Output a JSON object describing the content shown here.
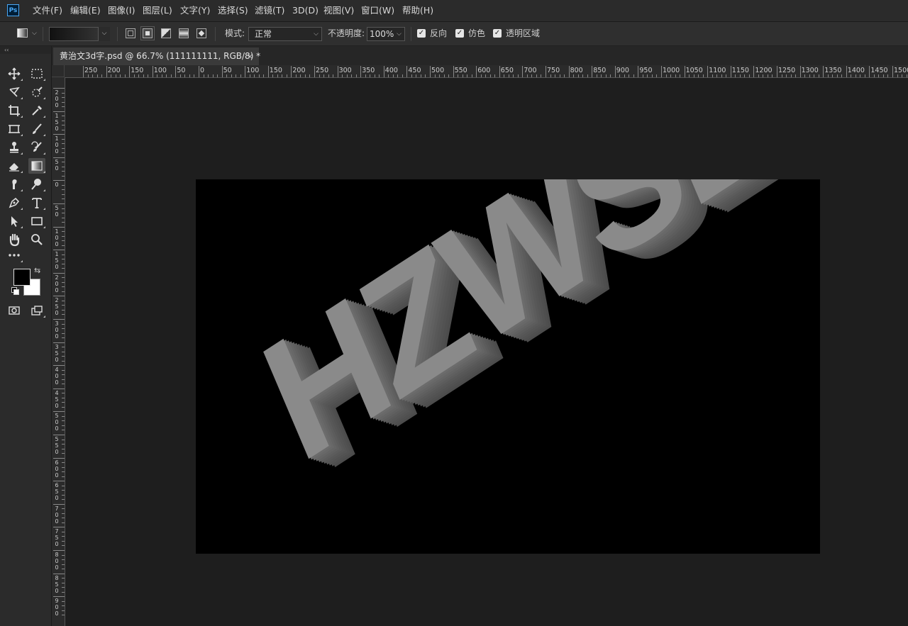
{
  "app": {
    "logo": "Ps"
  },
  "menu": [
    "文件(F)",
    "编辑(E)",
    "图像(I)",
    "图层(L)",
    "文字(Y)",
    "选择(S)",
    "滤镜(T)",
    "3D(D)",
    "视图(V)",
    "窗口(W)",
    "帮助(H)"
  ],
  "options": {
    "mode_label": "模式:",
    "mode_value": "正常",
    "opacity_label": "不透明度:",
    "opacity_value": "100%",
    "reverse_label": "反向",
    "dither_label": "仿色",
    "transparency_label": "透明区域",
    "reverse_checked": true,
    "dither_checked": true,
    "transparency_checked": true
  },
  "tools_panel": {
    "collapse_glyph": "‹‹"
  },
  "tools": [
    "move-tool",
    "marquee-tool",
    "lasso-tool",
    "quick-select-tool",
    "crop-tool",
    "eyedropper-tool",
    "frame-tool",
    "brush-tool",
    "stamp-tool",
    "history-brush-tool",
    "eraser-tool",
    "gradient-tool",
    "smudge-tool",
    "dodge-tool",
    "pen-tool",
    "type-tool",
    "path-select-tool",
    "rectangle-tool",
    "hand-tool",
    "zoom-tool",
    "more-tools"
  ],
  "colors": {
    "foreground": "#000000",
    "background": "#ffffff"
  },
  "document": {
    "tab_title": "黄治文3d字.psd @ 66.7% (111111111, RGB/8) *",
    "close_glyph": "×",
    "zoom": "66.7%"
  },
  "ruler_h_labels": [
    "250",
    "200",
    "150",
    "100",
    "50",
    "0",
    "50",
    "100",
    "150",
    "200",
    "250",
    "300",
    "350",
    "400",
    "450",
    "500",
    "550",
    "600",
    "650",
    "700",
    "750",
    "800",
    "850",
    "900",
    "950",
    "1000",
    "1050",
    "1100",
    "1150",
    "1200",
    "1250",
    "1300",
    "1350",
    "1400",
    "1450",
    "1500"
  ],
  "ruler_v_labels": [
    "200",
    "150",
    "100",
    "50",
    "0",
    "50",
    "100",
    "150",
    "200",
    "250",
    "300",
    "350",
    "400",
    "450",
    "500",
    "550",
    "600",
    "650",
    "700",
    "750",
    "800",
    "850",
    "900"
  ],
  "canvas": {
    "text": "HZWSB",
    "background": "#000000",
    "text_color": "#8a8a8a"
  }
}
